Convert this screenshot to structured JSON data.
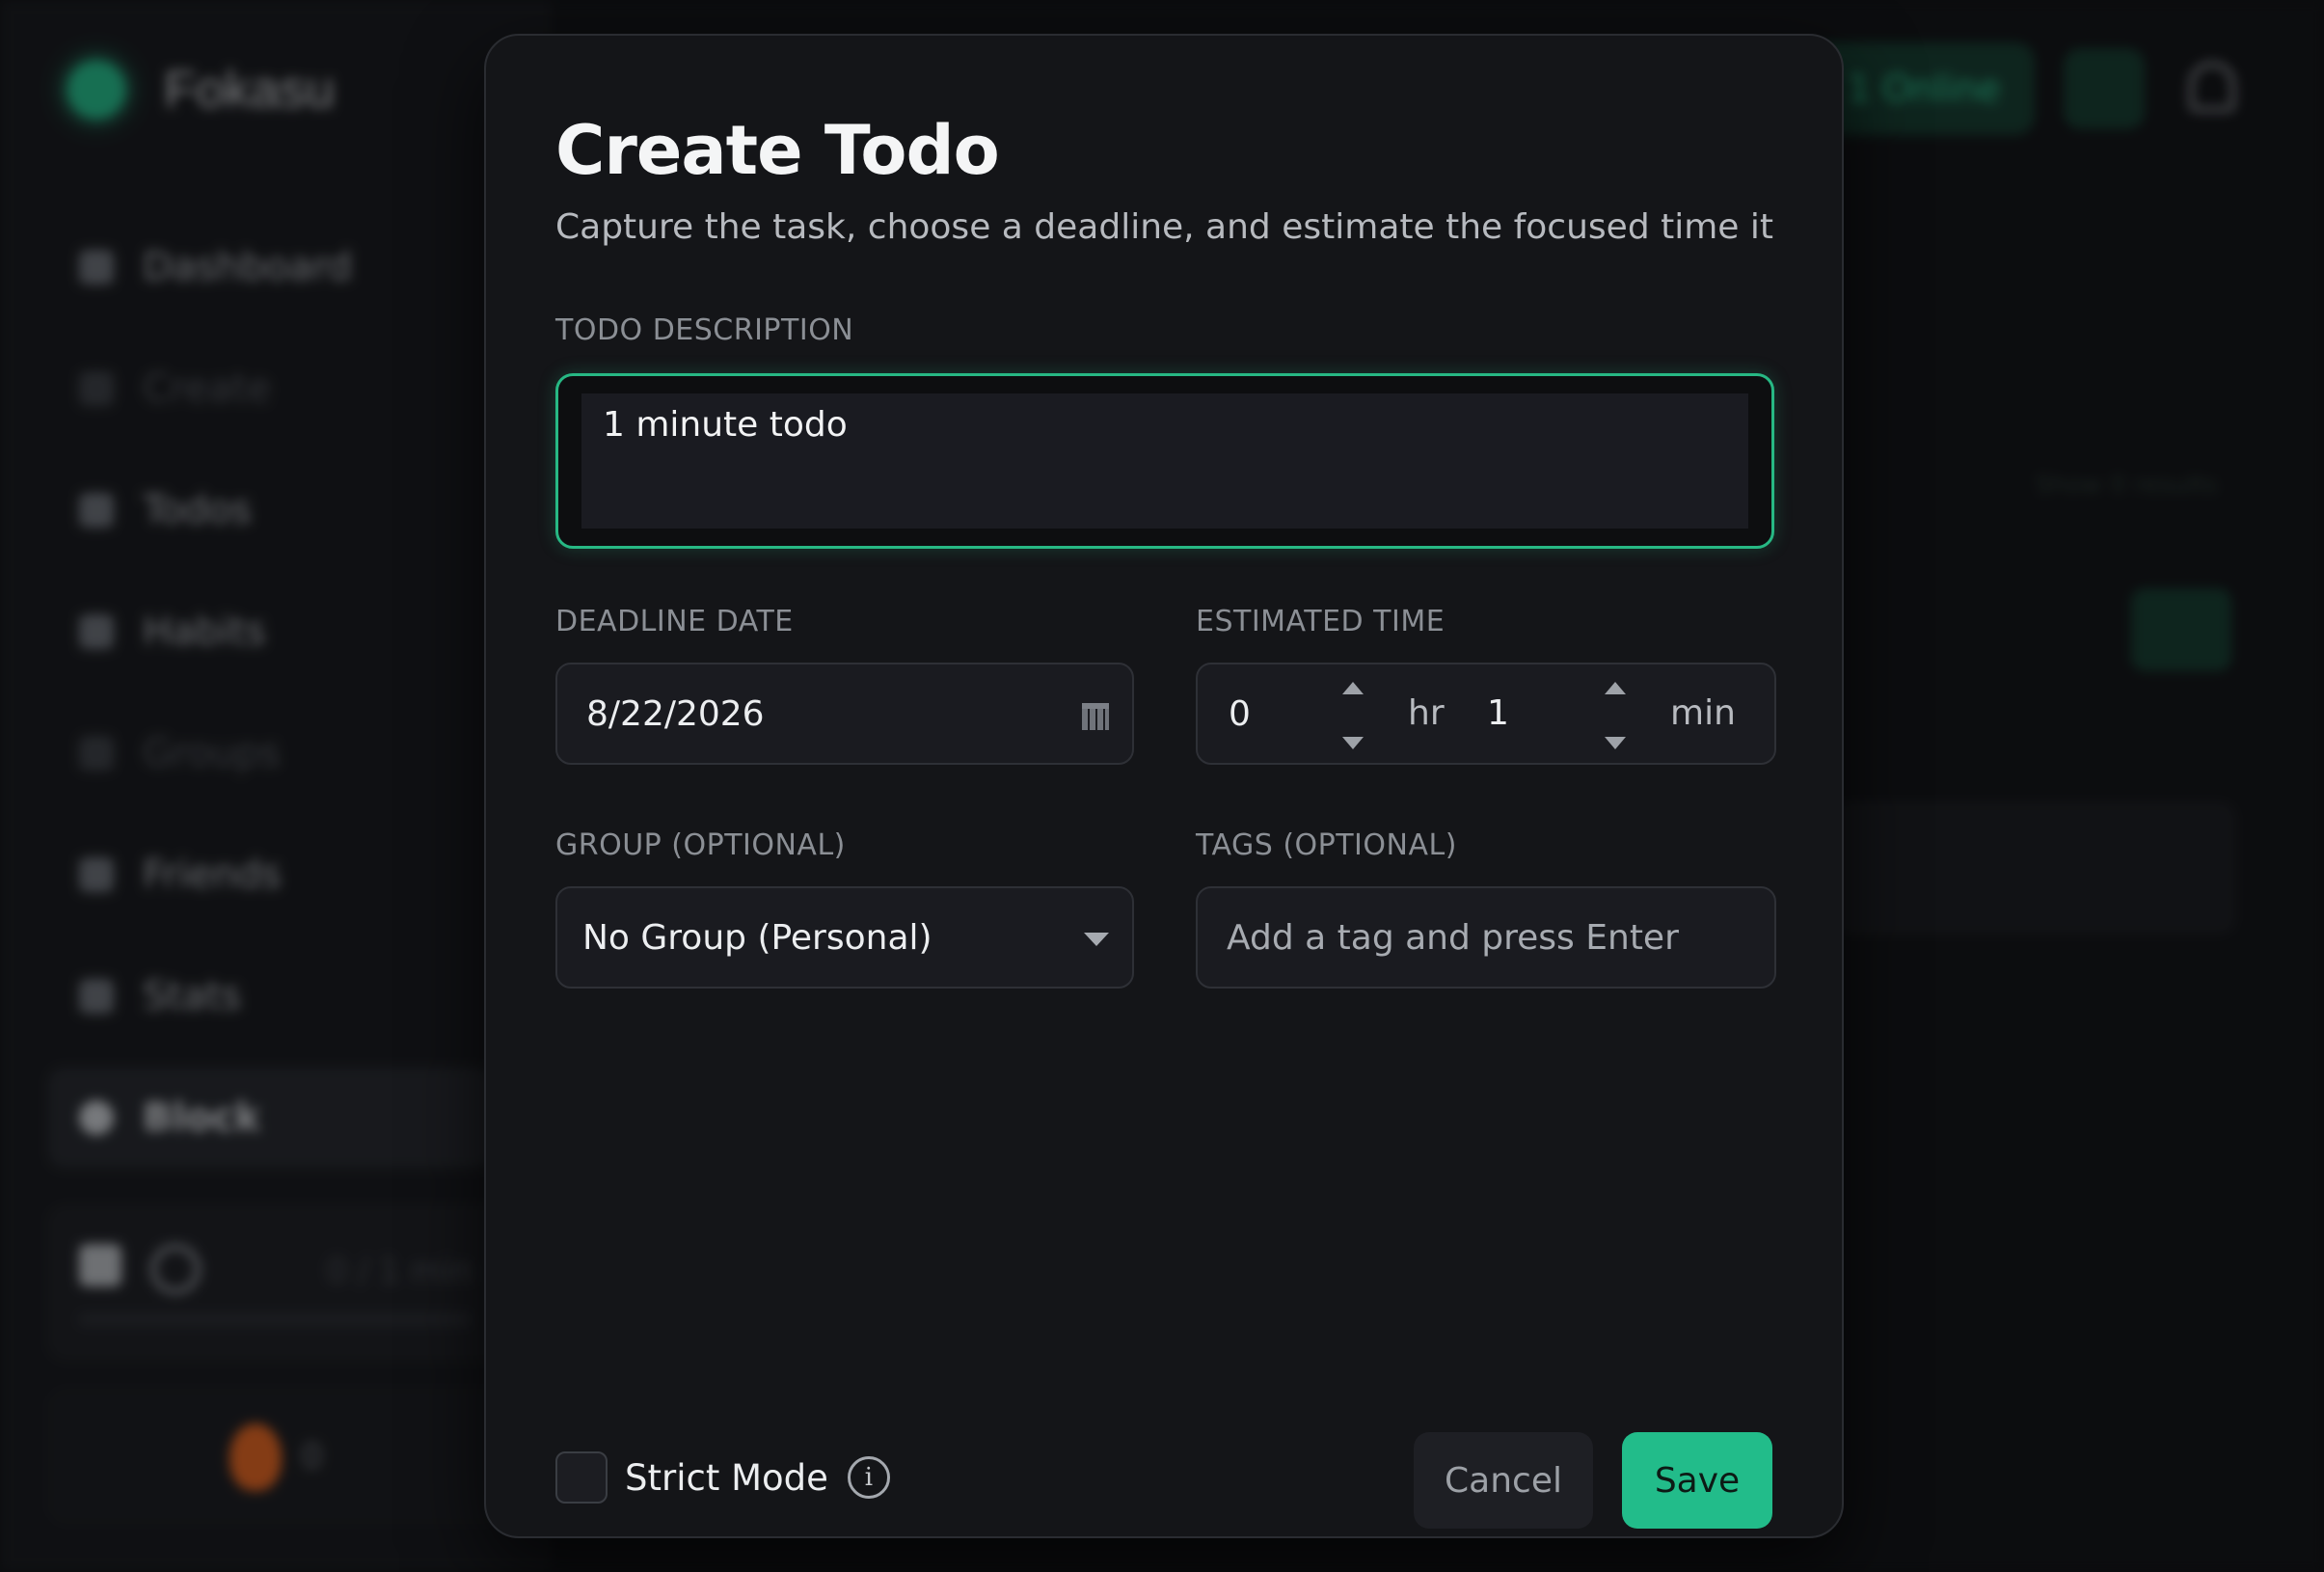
{
  "background": {
    "brand_name": "Fokasu",
    "nav": [
      {
        "label": "Dashboard",
        "state": "normal"
      },
      {
        "label": "Create",
        "state": "dim"
      },
      {
        "label": "Todos",
        "state": "normal"
      },
      {
        "label": "Habits",
        "state": "normal"
      },
      {
        "label": "Groups",
        "state": "dim"
      },
      {
        "label": "Friends",
        "state": "normal"
      },
      {
        "label": "Stats",
        "state": "normal"
      },
      {
        "label": "Block",
        "state": "active"
      }
    ],
    "session_count": "0 / 1 min",
    "streak": "0",
    "online": "1 Online",
    "faint_link": "Show 0 results"
  },
  "modal": {
    "title": "Create Todo",
    "subtitle": "Capture the task, choose a deadline, and estimate the focused time it",
    "description": {
      "label": "TODO DESCRIPTION",
      "value": "1 minute todo"
    },
    "deadline": {
      "label": "DEADLINE DATE",
      "value": "8/22/2026"
    },
    "estimated": {
      "label": "ESTIMATED TIME",
      "hours": "0",
      "hours_unit": "hr",
      "minutes": "1",
      "minutes_unit": "min"
    },
    "group": {
      "label": "GROUP (OPTIONAL)",
      "value": "No Group (Personal)"
    },
    "tags": {
      "label": "TAGS (OPTIONAL)",
      "placeholder": "Add a tag and press Enter"
    },
    "strict_mode_label": "Strict Mode",
    "info_glyph": "i",
    "cancel_label": "Cancel",
    "save_label": "Save"
  },
  "colors": {
    "accent": "#22bc8a",
    "surface": "#141518",
    "field": "#1a1b20"
  }
}
